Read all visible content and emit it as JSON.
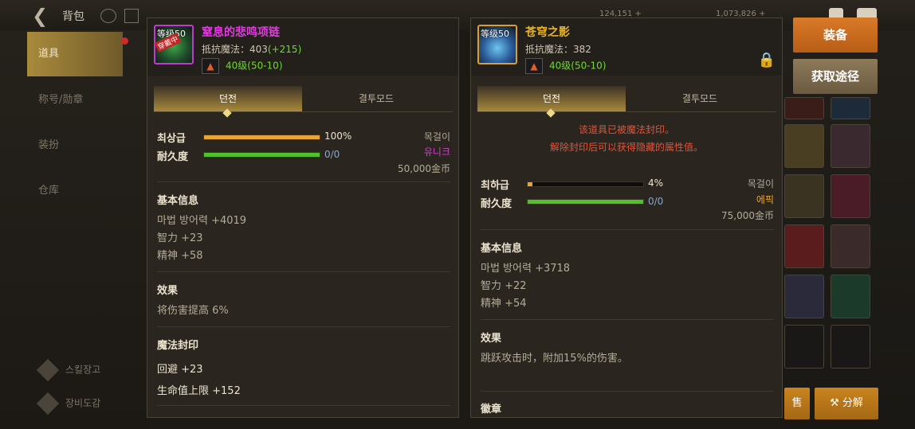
{
  "topbar": {
    "title": "背包",
    "stat1": "124,151 +",
    "stat2": "1,073,826 +"
  },
  "sidebar": {
    "items": [
      {
        "label": "道具"
      },
      {
        "label": "称号/勋章"
      },
      {
        "label": "装扮"
      },
      {
        "label": "仓库"
      }
    ],
    "bottom": [
      {
        "label": "스킬장고"
      },
      {
        "label": "장비도감"
      }
    ]
  },
  "left_panel": {
    "icon_level": "等级50",
    "icon_badge": "穿戴中",
    "name": "窒息的悲鸣项链",
    "name_color": "#e03ce0",
    "stat_label": "抵抗魔法：",
    "stat_value": "403",
    "stat_bonus": "(+215)",
    "level_req": "40级(50-10)",
    "tabs": [
      "던전",
      "결투모드"
    ],
    "grade_label": "최상급",
    "grade_percent": 100,
    "grade_value": "100%",
    "durability_label": "耐久度",
    "durability_percent": 100,
    "durability_value": "0/0",
    "type": "목걸이",
    "rarity": "유니크",
    "rarity_color": "#d43ad4",
    "price": "50,000金币",
    "basic_title": "基本信息",
    "basic_lines": [
      "마법 방어력 +4019",
      "智力 +23",
      "精神 +58"
    ],
    "effect_title": "效果",
    "effect_lines": [
      "将伤害提高 6%"
    ],
    "seal_title": "魔法封印",
    "seal_lines": [
      "回避 +23",
      "生命值上限 +152"
    ]
  },
  "right_panel": {
    "icon_level": "等级50",
    "name": "苍穹之影",
    "name_color": "#e8b42a",
    "stat_label": "抵抗魔法：",
    "stat_value": "382",
    "level_req": "40级(50-10)",
    "tabs": [
      "던전",
      "결투모드"
    ],
    "seal_msg1": "该道具已被魔法封印。",
    "seal_msg2": "解除封印后可以获得隐藏的属性值。",
    "grade_label": "최하급",
    "grade_percent": 4,
    "grade_value": "4%",
    "durability_label": "耐久度",
    "durability_percent": 100,
    "durability_value": "0/0",
    "type": "목걸이",
    "rarity": "에픽",
    "rarity_color": "#e8a42a",
    "price": "75,000金币",
    "basic_title": "基本信息",
    "basic_lines": [
      "마법 방어력 +3718",
      "智力 +22",
      "精神 +54"
    ],
    "effect_title": "效果",
    "effect_lines": [
      "跳跃攻击时，附加15%的伤害。"
    ],
    "next_title": "徽章"
  },
  "actions": {
    "equip": "装备",
    "source": "获取途径",
    "bottom_left": "售",
    "bottom_right": "分解"
  }
}
